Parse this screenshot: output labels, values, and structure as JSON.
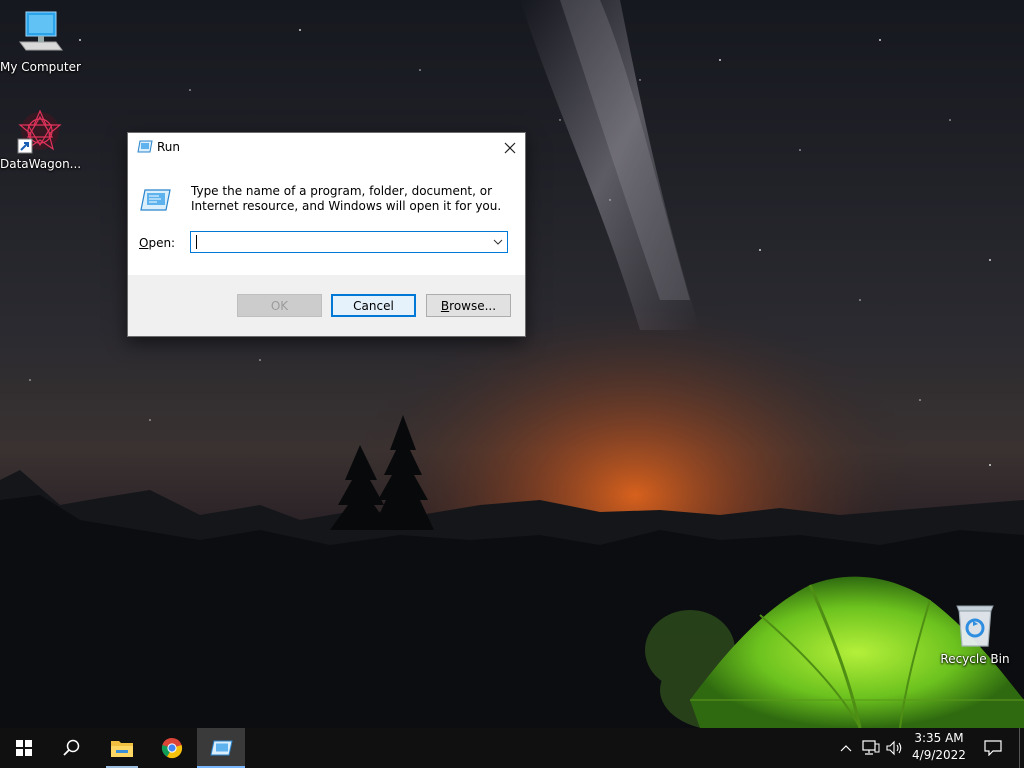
{
  "desktop": {
    "icons": [
      {
        "label": "My Computer",
        "icon": "computer-icon"
      },
      {
        "label": "DataWagon...",
        "icon": "datawagon-shortcut-icon"
      },
      {
        "label": "Recycle Bin",
        "icon": "recycle-bin-icon"
      }
    ]
  },
  "run_dialog": {
    "title": "Run",
    "description": "Type the name of a program, folder, document, or Internet resource, and Windows will open it for you.",
    "open_label_prefix": "",
    "open_label_accel": "O",
    "open_label_rest": "pen:",
    "open_value": "",
    "buttons": {
      "ok": "OK",
      "cancel": "Cancel",
      "browse_accel": "B",
      "browse_rest": "rowse..."
    }
  },
  "taskbar": {
    "items": [
      "start-icon",
      "search-icon",
      "file-explorer-icon",
      "chrome-icon",
      "run-icon"
    ],
    "tray": {
      "time": "3:35 AM",
      "date": "4/9/2022"
    }
  },
  "colors": {
    "accent": "#0078d7",
    "taskbar": "#101010",
    "dialog_footer": "#f0f0f0"
  }
}
